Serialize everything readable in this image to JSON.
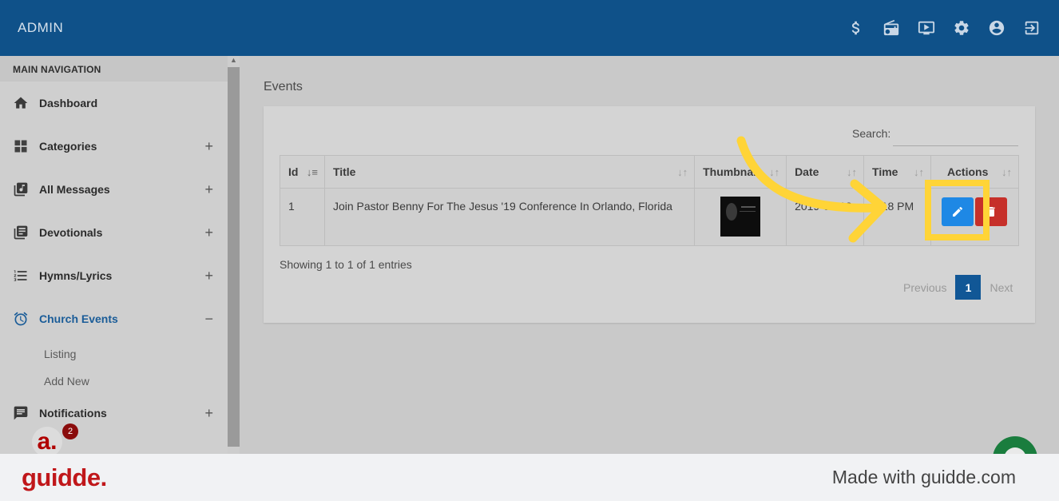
{
  "header": {
    "brand": "ADMIN",
    "icons": [
      "dollar-icon",
      "radio-icon",
      "tv-icon",
      "gear-icon",
      "account-icon",
      "logout-icon"
    ]
  },
  "sidebar": {
    "section": "MAIN NAVIGATION",
    "items": [
      {
        "label": "Dashboard",
        "icon": "home-icon",
        "toggle": ""
      },
      {
        "label": "Categories",
        "icon": "categories-icon",
        "toggle": "+"
      },
      {
        "label": "All Messages",
        "icon": "music-library-icon",
        "toggle": "+"
      },
      {
        "label": "Devotionals",
        "icon": "book-icon",
        "toggle": "+"
      },
      {
        "label": "Hymns/Lyrics",
        "icon": "list-icon",
        "toggle": "+"
      },
      {
        "label": "Church Events",
        "icon": "alarm-clock-icon",
        "toggle": "−"
      },
      {
        "label": "Notifications",
        "icon": "message-icon",
        "toggle": "+"
      }
    ],
    "sub_items": [
      "Listing",
      "Add New"
    ],
    "avatar": {
      "letter": "a.",
      "badge": "2"
    }
  },
  "main": {
    "title": "Events",
    "search_label": "Search:",
    "search_value": "",
    "columns": [
      "Id",
      "Title",
      "Thumbnail",
      "Date",
      "Time",
      "Actions"
    ],
    "rows": [
      {
        "id": "1",
        "title": "Join Pastor Benny For The Jesus '19 Conference In Orlando, Florida",
        "date": "2019-06-12",
        "time": "6:18 PM"
      }
    ],
    "info": "Showing 1 to 1 of 1 entries",
    "pager": {
      "prev": "Previous",
      "page": "1",
      "next": "Next"
    }
  },
  "footer": {
    "logo": "guidde.",
    "tagline": "Made with guidde.com"
  },
  "colors": {
    "topbar": "#0f5189",
    "accent": "#1e88e5",
    "danger": "#c6302a",
    "highlight": "#ffd437",
    "brand_red": "#c0171a"
  }
}
